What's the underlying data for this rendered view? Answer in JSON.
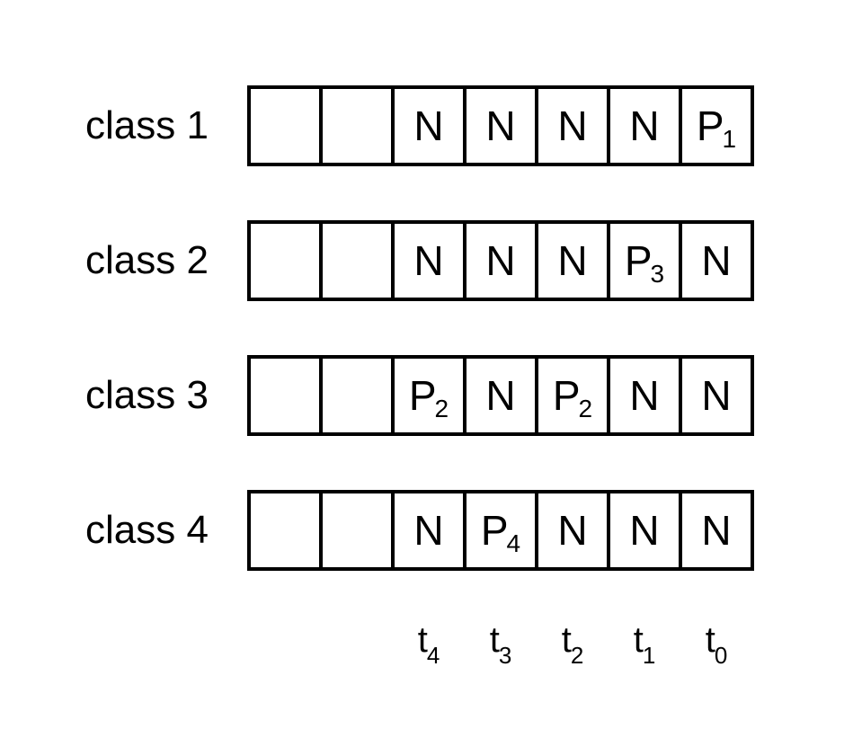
{
  "rows": [
    {
      "label": "class 1",
      "cells": [
        "",
        "",
        "N",
        "N",
        "N",
        "N",
        "P1"
      ]
    },
    {
      "label": "class 2",
      "cells": [
        "",
        "",
        "N",
        "N",
        "N",
        "P3",
        "N"
      ]
    },
    {
      "label": "class 3",
      "cells": [
        "",
        "",
        "P2",
        "N",
        "P2",
        "N",
        "N"
      ]
    },
    {
      "label": "class 4",
      "cells": [
        "",
        "",
        "N",
        "P4",
        "N",
        "N",
        "N"
      ]
    }
  ],
  "timeLabels": [
    "",
    "",
    "t4",
    "t3",
    "t2",
    "t1",
    "t0"
  ],
  "layout": {
    "rowTops": [
      95,
      245,
      395,
      545
    ],
    "timeTop": 690
  }
}
